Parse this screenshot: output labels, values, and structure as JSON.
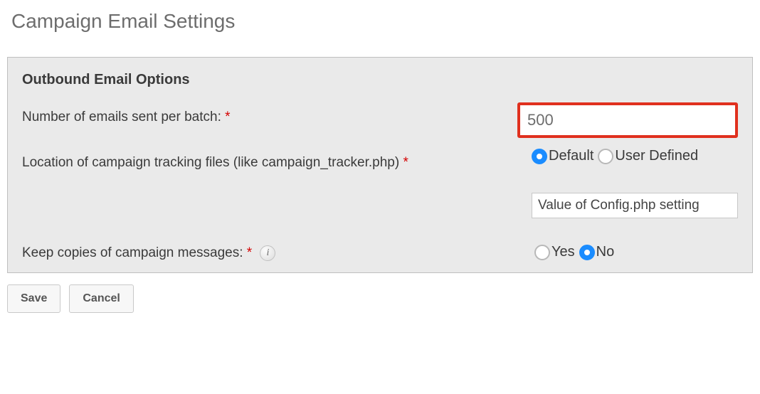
{
  "page": {
    "title": "Campaign Email Settings"
  },
  "section": {
    "heading": "Outbound Email Options",
    "fields": {
      "batch": {
        "label": "Number of emails sent per batch: ",
        "required": "*",
        "value": "500"
      },
      "tracking": {
        "label": "Location of campaign tracking files (like campaign_tracker.php) ",
        "required": "*",
        "options": {
          "default": "Default",
          "user": "User Defined"
        },
        "config_value": "Value of Config.php setting"
      },
      "keep": {
        "label": "Keep copies of campaign messages: ",
        "required": "*",
        "options": {
          "yes": "Yes",
          "no": "No"
        }
      }
    }
  },
  "buttons": {
    "save": "Save",
    "cancel": "Cancel"
  }
}
